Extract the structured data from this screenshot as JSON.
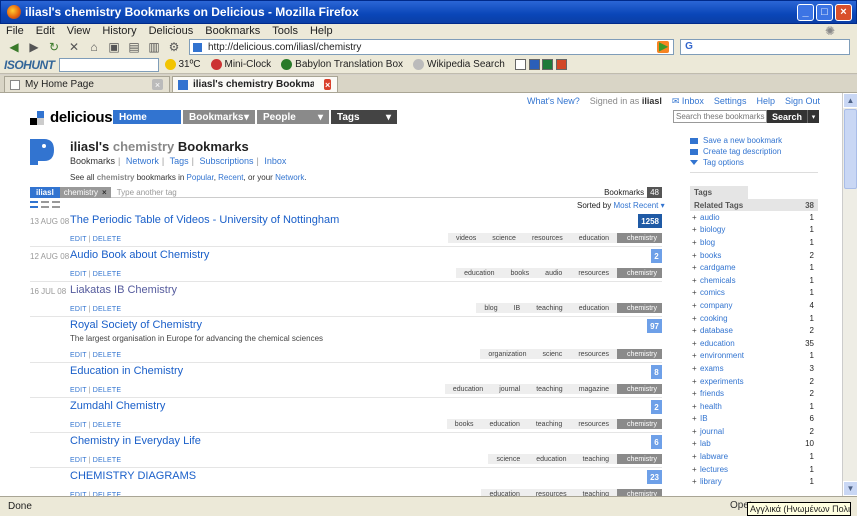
{
  "window": {
    "title": "iliasl's chemistry Bookmarks on Delicious - Mozilla Firefox",
    "min": "_",
    "max": "□",
    "close": "×"
  },
  "menu": [
    "File",
    "Edit",
    "View",
    "History",
    "Delicious",
    "Bookmarks",
    "Tools",
    "Help"
  ],
  "address": {
    "url": "http://delicious.com/iliasl/chemistry"
  },
  "toolbar2": {
    "brand": "ISOHUNT",
    "weather": "31ºC",
    "miniclock": "Mini-Clock",
    "babylon": "Babylon Translation Box",
    "wikipedia": "Wikipedia Search"
  },
  "tabs": [
    {
      "label": "My Home Page"
    },
    {
      "label": "iliasl's chemistry Bookmarks on Delicious"
    }
  ],
  "topnav": {
    "whats_new": "What's New?",
    "signed_in": "Signed in as",
    "user": "iliasl",
    "inbox": "Inbox",
    "settings": "Settings",
    "help": "Help",
    "signout": "Sign Out"
  },
  "logo": {
    "name": "delicious"
  },
  "mainnav": {
    "home": "Home",
    "bookmarks": "Bookmarks",
    "people": "People",
    "tags": "Tags"
  },
  "search": {
    "placeholder": "Search these bookmarks",
    "button": "Search"
  },
  "header": {
    "user": "iliasl's",
    "tag": "chemistry",
    "suffix": "Bookmarks",
    "subnav": [
      "Bookmarks",
      "Network",
      "Tags",
      "Subscriptions",
      "Inbox"
    ]
  },
  "seeall": {
    "pre": "See all",
    "tag": "chemistry",
    "mid": "bookmarks in",
    "popular": "Popular",
    "recent": "Recent",
    "or": ", or your",
    "network": "Network"
  },
  "sidelinks": [
    "Save a new bookmark",
    "Create tag description",
    "Tag options"
  ],
  "crumb": {
    "user": "iliasl",
    "tag": "chemistry",
    "x": "×",
    "another": "Type another tag",
    "bookmarks_label": "Bookmarks",
    "bookmarks_count": "48"
  },
  "sort": {
    "label": "Sorted by",
    "value": "Most Recent"
  },
  "bookmarks": [
    {
      "date": "13 AUG 08",
      "title": "The Periodic Table of Videos - University of Nottingham",
      "desc": "",
      "count": "1258",
      "tags": [
        "videos",
        "science",
        "resources",
        "education",
        "chemistry"
      ]
    },
    {
      "date": "12 AUG 08",
      "title": "Audio Book about Chemistry",
      "desc": "",
      "count": "2",
      "tags": [
        "education",
        "books",
        "audio",
        "resources",
        "chemistry"
      ]
    },
    {
      "date": "16 JUL 08",
      "title": "Liakatas IB Chemistry",
      "desc": "",
      "count": "",
      "tags": [
        "blog",
        "IB",
        "teaching",
        "education",
        "chemistry"
      ]
    },
    {
      "date": "",
      "title": "Royal Society of Chemistry",
      "desc": "The largest organisation in Europe for advancing the chemical sciences",
      "count": "97",
      "tags": [
        "organization",
        "scienc",
        "resources",
        "chemistry"
      ]
    },
    {
      "date": "",
      "title": "Education in Chemistry",
      "desc": "",
      "count": "8",
      "tags": [
        "education",
        "journal",
        "teaching",
        "magazine",
        "chemistry"
      ]
    },
    {
      "date": "",
      "title": "Zumdahl Chemistry",
      "desc": "",
      "count": "2",
      "tags": [
        "books",
        "education",
        "teaching",
        "resources",
        "chemistry"
      ]
    },
    {
      "date": "",
      "title": "Chemistry in Everyday Life",
      "desc": "",
      "count": "6",
      "tags": [
        "science",
        "education",
        "teaching",
        "chemistry"
      ]
    },
    {
      "date": "",
      "title": "CHEMISTRY DIAGRAMS",
      "desc": "",
      "count": "23",
      "tags": [
        "education",
        "resources",
        "teaching",
        "chemistry"
      ]
    }
  ],
  "actions": {
    "edit": "EDIT",
    "delete": "DELETE",
    "sep": "|"
  },
  "tagpanel": {
    "tab": "Tags",
    "header": "Related Tags",
    "total": "38",
    "tags": [
      {
        "name": "audio",
        "count": "1"
      },
      {
        "name": "biology",
        "count": "1"
      },
      {
        "name": "blog",
        "count": "1"
      },
      {
        "name": "books",
        "count": "2"
      },
      {
        "name": "cardgame",
        "count": "1"
      },
      {
        "name": "chemicals",
        "count": "1"
      },
      {
        "name": "comics",
        "count": "1"
      },
      {
        "name": "company",
        "count": "4"
      },
      {
        "name": "cooking",
        "count": "1"
      },
      {
        "name": "database",
        "count": "2"
      },
      {
        "name": "education",
        "count": "35"
      },
      {
        "name": "environment",
        "count": "1"
      },
      {
        "name": "exams",
        "count": "3"
      },
      {
        "name": "experiments",
        "count": "2"
      },
      {
        "name": "friends",
        "count": "2"
      },
      {
        "name": "health",
        "count": "1"
      },
      {
        "name": "IB",
        "count": "6"
      },
      {
        "name": "journal",
        "count": "2"
      },
      {
        "name": "lab",
        "count": "10"
      },
      {
        "name": "labware",
        "count": "1"
      },
      {
        "name": "lectures",
        "count": "1"
      },
      {
        "name": "library",
        "count": "1"
      }
    ]
  },
  "status": {
    "text": "Done",
    "open": "Opet",
    "tip": "Αγγλικά (Ηνωμένων Πολιτειών)"
  }
}
